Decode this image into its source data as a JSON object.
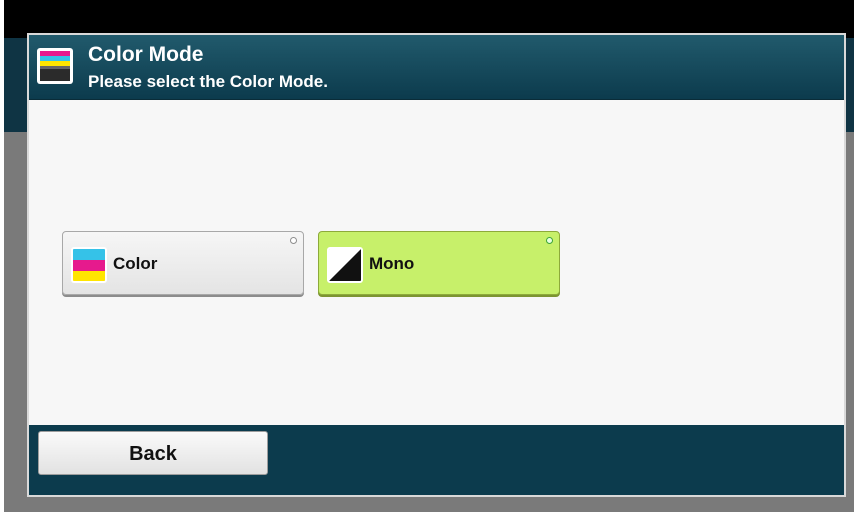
{
  "header": {
    "title": "Color Mode",
    "subtitle": "Please select the Color Mode.",
    "icon": "color-mode-icon"
  },
  "options": [
    {
      "label": "Color",
      "icon": "color-icon",
      "selected": false
    },
    {
      "label": "Mono",
      "icon": "mono-icon",
      "selected": true
    }
  ],
  "footer": {
    "back_label": "Back"
  },
  "colors": {
    "header_bg": "#0c3b4d",
    "selected_bg": "#c7f06a",
    "panel_bg": "#f7f7f7"
  }
}
